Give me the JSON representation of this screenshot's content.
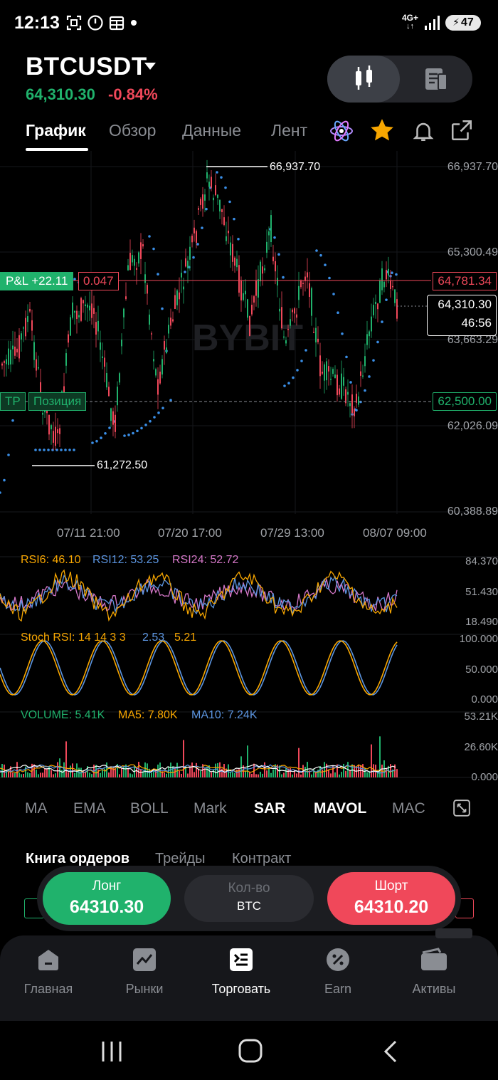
{
  "status": {
    "time": "12:13",
    "network": "4G+",
    "battery": "47"
  },
  "header": {
    "symbol": "BTCUSDT",
    "price": "64,310.30",
    "change": "-0.84%"
  },
  "tabs": [
    "График",
    "Обзор",
    "Данные",
    "Лент"
  ],
  "chart": {
    "watermark": "BYBIT",
    "price_axis": [
      "66,937.70",
      "65,300.49",
      "63,663.29",
      "62,026.09",
      "60,388.89"
    ],
    "time_axis": [
      "07/11 21:00",
      "07/20 17:00",
      "07/29 13:00",
      "08/07 09:00"
    ],
    "high_label": "66,937.70",
    "low_label": "61,272.50",
    "pnl_label": "P&L +22.11",
    "pnl_qty": "0.047",
    "entry_price": "64,781.34",
    "last_price": "64,310.30",
    "countdown": "46:56",
    "tp_label": "TP",
    "position_label": "Позиция",
    "tp_price": "62,500.00"
  },
  "rsi": {
    "rsi6": "RSI6: 46.10",
    "rsi12": "RSI12: 53.25",
    "rsi24": "RSI24: 52.72",
    "axis": [
      "84.370",
      "51.430",
      "18.490"
    ]
  },
  "stoch": {
    "label": "Stoch RSI: 14 14 3 3",
    "k": "2.53",
    "d": "5.21",
    "axis": [
      "100.000",
      "50.000",
      "0.000"
    ]
  },
  "volume": {
    "vol": "VOLUME: 5.41K",
    "ma5": "MA5: 7.80K",
    "ma10": "MA10: 7.24K",
    "axis": [
      "53.21K",
      "26.60K",
      "0.000"
    ]
  },
  "indicators": [
    "MA",
    "EMA",
    "BOLL",
    "Mark",
    "SAR",
    "MAVOL",
    "MAC"
  ],
  "orderbook_tabs": [
    "Книга ордеров",
    "Трейды",
    "Контракт"
  ],
  "trade": {
    "long_label": "Лонг",
    "long_price": "64310.30",
    "qty_label": "Кол-во",
    "qty_unit": "BTC",
    "short_label": "Шорт",
    "short_price": "64310.20"
  },
  "nav": [
    "Главная",
    "Рынки",
    "Торговать",
    "Earn",
    "Активы"
  ],
  "colors": {
    "up": "#20b26c",
    "down": "#f0485a",
    "accent": "#f7a600",
    "sar": "#3a8ee6"
  }
}
